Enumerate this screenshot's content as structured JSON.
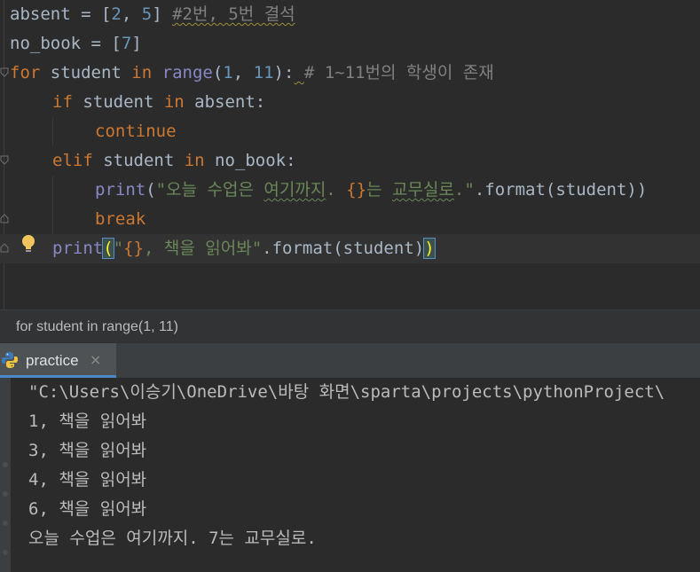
{
  "editor": {
    "lines": [
      {
        "tokens": [
          {
            "t": "absent",
            "c": "id"
          },
          {
            "t": " = [",
            "c": "id"
          },
          {
            "t": "2",
            "c": "num"
          },
          {
            "t": ", ",
            "c": "id"
          },
          {
            "t": "5",
            "c": "num"
          },
          {
            "t": "] ",
            "c": "id"
          },
          {
            "t": "#2번, 5번 결석",
            "c": "cmt warn-y"
          }
        ]
      },
      {
        "tokens": [
          {
            "t": "no_book",
            "c": "id"
          },
          {
            "t": " = [",
            "c": "id"
          },
          {
            "t": "7",
            "c": "num"
          },
          {
            "t": "]",
            "c": "id"
          }
        ]
      },
      {
        "tokens": [
          {
            "t": "for",
            "c": "kw"
          },
          {
            "t": " student ",
            "c": "id"
          },
          {
            "t": "in",
            "c": "kw"
          },
          {
            "t": " ",
            "c": "id"
          },
          {
            "t": "range",
            "c": "bi"
          },
          {
            "t": "(",
            "c": "id"
          },
          {
            "t": "1",
            "c": "num"
          },
          {
            "t": ", ",
            "c": "id"
          },
          {
            "t": "11",
            "c": "num"
          },
          {
            "t": "):",
            "c": "id"
          },
          {
            "t": " ",
            "c": "id warn-y"
          },
          {
            "t": "# 1~11번의 학생이 존재",
            "c": "cmt"
          }
        ]
      },
      {
        "tokens": [
          {
            "t": "if",
            "c": "kw"
          },
          {
            "t": " student ",
            "c": "id"
          },
          {
            "t": "in",
            "c": "kw"
          },
          {
            "t": " absent:",
            "c": "id"
          }
        ]
      },
      {
        "tokens": [
          {
            "t": "continue",
            "c": "kw"
          }
        ]
      },
      {
        "tokens": [
          {
            "t": "elif",
            "c": "kw"
          },
          {
            "t": " student ",
            "c": "id"
          },
          {
            "t": "in",
            "c": "kw"
          },
          {
            "t": " no_book:",
            "c": "id"
          }
        ]
      },
      {
        "tokens": [
          {
            "t": "print",
            "c": "bi"
          },
          {
            "t": "(",
            "c": "id"
          },
          {
            "t": "\"오늘 수업은 ",
            "c": "str"
          },
          {
            "t": "여기까지",
            "c": "str warn"
          },
          {
            "t": ". ",
            "c": "str"
          },
          {
            "t": "{}",
            "c": "kw"
          },
          {
            "t": "는 ",
            "c": "str"
          },
          {
            "t": "교무실로",
            "c": "str warn"
          },
          {
            "t": ".\"",
            "c": "str"
          },
          {
            "t": ".format(student))",
            "c": "id"
          }
        ]
      },
      {
        "tokens": [
          {
            "t": "break",
            "c": "kw"
          }
        ]
      },
      {
        "tokens": [
          {
            "t": "print",
            "c": "bi"
          },
          {
            "t": "(",
            "c": "id brace-hl"
          },
          {
            "t": "\"",
            "c": "str"
          },
          {
            "t": "{}",
            "c": "kw"
          },
          {
            "t": ", 책을 읽어봐\"",
            "c": "str"
          },
          {
            "t": ".format(student)",
            "c": "id"
          },
          {
            "t": ")",
            "c": "id brace-hl"
          }
        ]
      }
    ]
  },
  "breadcrumb": {
    "text": "for student in range(1, 11)"
  },
  "run_window": {
    "tab_label": "practice",
    "close_glyph": "×",
    "output_lines": [
      "\"C:\\Users\\이승기\\OneDrive\\바탕 화면\\sparta\\projects\\pythonProject\\",
      "1, 책을 읽어봐",
      "3, 책을 읽어봐",
      "4, 책을 읽어봐",
      "6, 책을 읽어봐",
      "오늘 수업은 여기까지. 7는 교무실로."
    ]
  },
  "colors": {
    "editor_bg": "#2b2b2b",
    "keyword": "#cc7832",
    "number": "#6897bb",
    "builtin": "#8888c6",
    "string": "#6a8759",
    "comment": "#808080",
    "accent": "#4a88c7"
  },
  "icons": {
    "intention": "lightbulb-icon",
    "run_config": "python-icon",
    "fold": "fold-marker-icon"
  }
}
